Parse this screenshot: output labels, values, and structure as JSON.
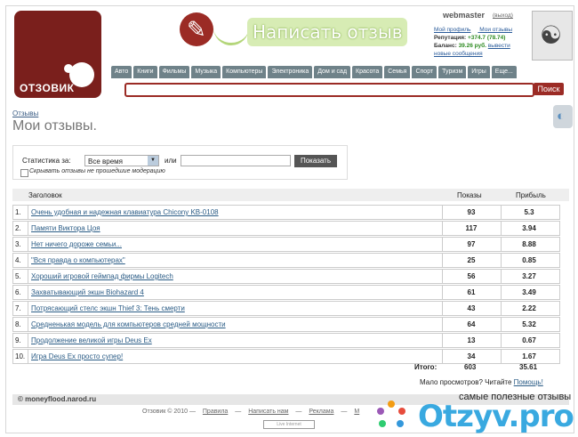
{
  "logo": {
    "text": "ОТЗОВИК"
  },
  "banner": {
    "text": "Написать отзыв"
  },
  "user": {
    "name": "webmaster",
    "logout": "(выход)",
    "links": [
      "Мой профиль",
      "Мои отзывы"
    ],
    "reputation_label": "Репутация:",
    "reputation_value": "+374.7 (78.74)",
    "balance_label": "Баланс:",
    "balance_value": "39.26 руб.",
    "withdraw": "вывести",
    "messages": "новые сообщения"
  },
  "nav": [
    "Авто",
    "Книги",
    "Фильмы",
    "Музыка",
    "Компьютеры",
    "Электроника",
    "Дом и сад",
    "Красота",
    "Семья",
    "Спорт",
    "Туризм",
    "Игры",
    "Еще..."
  ],
  "search": {
    "button": "Поиск",
    "value": ""
  },
  "breadcrumb": "Отзывы",
  "title": "Мои отзывы.",
  "filter": {
    "label": "Статистика за:",
    "select_value": "Все время",
    "or": "или",
    "date_value": "",
    "button": "Показать",
    "checkbox_label": "Скрывать отзывы не прошедшие модерацию"
  },
  "table": {
    "headers": [
      "Заголовок",
      "Показы",
      "Прибыль"
    ],
    "rows": [
      {
        "n": "1.",
        "title": "Очень удобная и надежная клавиатура Chicony KB-0108",
        "views": "93",
        "profit": "5.3"
      },
      {
        "n": "2.",
        "title": "Памяти Виктора Цоя",
        "views": "117",
        "profit": "3.94"
      },
      {
        "n": "3.",
        "title": "Нет ничего дороже семьи...",
        "views": "97",
        "profit": "8.88"
      },
      {
        "n": "4.",
        "title": "\"Вся правда о компьютерах\"",
        "views": "25",
        "profit": "0.85"
      },
      {
        "n": "5.",
        "title": "Хороший игровой геймпад фирмы Logitech",
        "views": "56",
        "profit": "3.27"
      },
      {
        "n": "6.",
        "title": "Захватывающий экшн Biohazard 4",
        "views": "61",
        "profit": "3.49"
      },
      {
        "n": "7.",
        "title": "Потрясающий стелс экшн Thief 3: Тень смерти",
        "views": "43",
        "profit": "2.22"
      },
      {
        "n": "8.",
        "title": "Средненькая модель для компьютеров средней мощности",
        "views": "64",
        "profit": "5.32"
      },
      {
        "n": "9.",
        "title": "Продолжение великой игры Deus Ex",
        "views": "13",
        "profit": "0.67"
      },
      {
        "n": "10.",
        "title": "Игра Deus Ex просто супер!",
        "views": "34",
        "profit": "1.67"
      }
    ],
    "total_label": "Итого:",
    "total_views": "603",
    "total_profit": "35.61"
  },
  "help": {
    "text": "Мало просмотров? Читайте",
    "link": "Помощь!"
  },
  "watermark_left": "© moneyflood.narod.ru",
  "footer": {
    "copyright": "Отзовик © 2010",
    "links": [
      "Правила",
      "Написать нам",
      "Реклама",
      "М"
    ],
    "live": "Live Internet"
  },
  "otzyv": {
    "sub": "самые полезные отзывы",
    "brand": "Otzyv.pro"
  }
}
